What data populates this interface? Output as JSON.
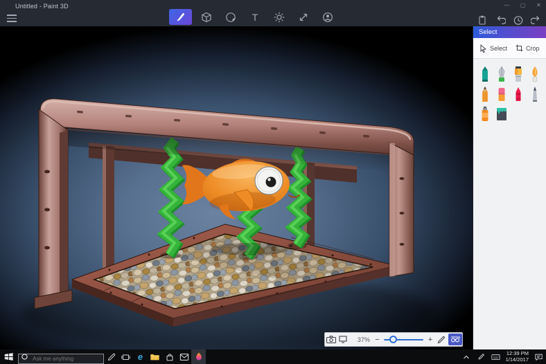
{
  "titlebar": {
    "title": "Untitled - Paint 3D",
    "minimize_glyph": "—",
    "maximize_glyph": "▢",
    "close_glyph": "✕"
  },
  "toolbar": {
    "tools": [
      "brush",
      "3d-shapes",
      "stickers",
      "text",
      "effects",
      "canvas",
      "remix-3d"
    ],
    "selected_tool": "brush",
    "text_tool_glyph": "T",
    "history_icons": [
      "paste",
      "undo",
      "history",
      "redo"
    ]
  },
  "panel": {
    "header": "Select",
    "select_button": "Select",
    "crop_button": "Crop",
    "brush_icons": [
      "marker",
      "calligraphy-pen",
      "oil-brush",
      "watercolor",
      "pencil",
      "eraser",
      "crayon",
      "pixel-pen",
      "spray-can",
      "fill-bucket"
    ]
  },
  "scene": {
    "objects": [
      "tank-frame",
      "pebble-floor",
      "seaweed-left",
      "seaweed-middle",
      "seaweed-right",
      "fish"
    ]
  },
  "zoombar": {
    "zoom_percent": "37%",
    "minus_glyph": "−",
    "plus_glyph": "+",
    "icons": [
      "mixed-reality-camera",
      "zoom-frame",
      "2d-pencil",
      "3d-glasses"
    ]
  },
  "taskbar": {
    "search_placeholder": "Ask me anything",
    "time": "12:39 PM",
    "date": "1/14/2017",
    "icons": [
      "start",
      "cortana-search",
      "pen",
      "task-view",
      "edge",
      "file-explorer",
      "store",
      "mail",
      "paint-3d",
      "hidden-icons-chevron",
      "tray-pen",
      "touch-keyboard",
      "action-center"
    ]
  },
  "colors": {
    "accent_blue": "#2e5bd9",
    "accent_purple": "#7b3fc3",
    "header_bg": "#262a33",
    "taskbar_bg": "#0b0c0e",
    "glasses_button_bg": "#4a58c4",
    "fish_orange": "#ee8d26",
    "seaweed_green": "#35b33a",
    "copper": "#a3766f",
    "edge_blue": "#35aadc"
  }
}
